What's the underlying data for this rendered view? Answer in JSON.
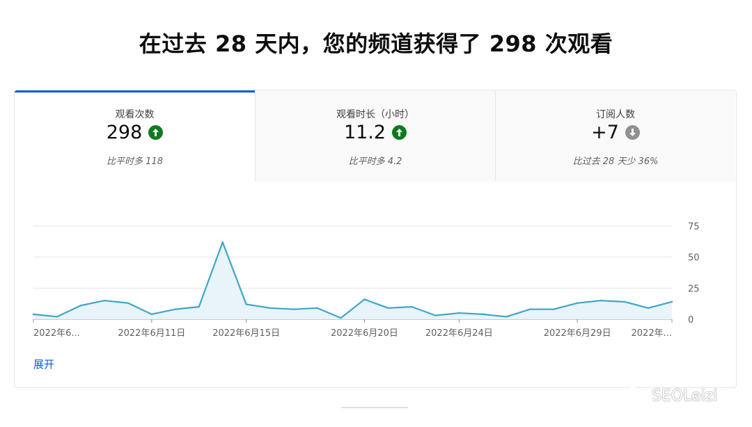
{
  "headline": "在过去 28 天内，您的频道获得了 298 次观看",
  "tabs": [
    {
      "title": "观看次数",
      "value": "298",
      "trend": "up",
      "trend_icon": "arrow-up-circle-icon",
      "comparison": "比平时多 118"
    },
    {
      "title": "观看时长（小时）",
      "value": "11.2",
      "trend": "up",
      "trend_icon": "arrow-up-circle-icon",
      "comparison": "比平时多 4.2"
    },
    {
      "title": "订阅人数",
      "value": "+7",
      "trend": "down",
      "trend_icon": "arrow-down-circle-icon",
      "comparison": "比过去 28 天少 36%"
    }
  ],
  "expand_label": "展开",
  "watermark": "SEOLeizi",
  "colors": {
    "accent": "#065fd4",
    "up": "#0f7a1f",
    "down": "#909090",
    "line": "#3ea6c6",
    "fill": "#e8f3fa"
  },
  "chart_data": {
    "type": "area",
    "x": [
      "2022年6月6日",
      "2022年6月7日",
      "2022年6月8日",
      "2022年6月9日",
      "2022年6月10日",
      "2022年6月11日",
      "2022年6月12日",
      "2022年6月13日",
      "2022年6月14日",
      "2022年6月15日",
      "2022年6月16日",
      "2022年6月17日",
      "2022年6月18日",
      "2022年6月19日",
      "2022年6月20日",
      "2022年6月21日",
      "2022年6月22日",
      "2022年6月23日",
      "2022年6月24日",
      "2022年6月25日",
      "2022年6月26日",
      "2022年6月27日",
      "2022年6月28日",
      "2022年6月29日",
      "2022年6月30日",
      "2022年7月1日",
      "2022年7月2日",
      "2022年7月3日"
    ],
    "series": [
      {
        "values": [
          4,
          2,
          11,
          15,
          13,
          4,
          8,
          10,
          62,
          12,
          9,
          8,
          9,
          1,
          16,
          9,
          10,
          3,
          5,
          4,
          2,
          8,
          8,
          13,
          15,
          14,
          9,
          14
        ]
      }
    ],
    "ylim": [
      0,
      75
    ],
    "yticks": [
      0,
      25,
      50,
      75
    ],
    "xtick_labels": [
      {
        "index": 0,
        "label": "2022年6..."
      },
      {
        "index": 5,
        "label": "2022年6月11日"
      },
      {
        "index": 9,
        "label": "2022年6月15日"
      },
      {
        "index": 14,
        "label": "2022年6月20日"
      },
      {
        "index": 18,
        "label": "2022年6月24日"
      },
      {
        "index": 23,
        "label": "2022年6月29日"
      },
      {
        "index": 27,
        "label": "2022年..."
      }
    ],
    "grid": true,
    "y_axis_side": "right"
  }
}
